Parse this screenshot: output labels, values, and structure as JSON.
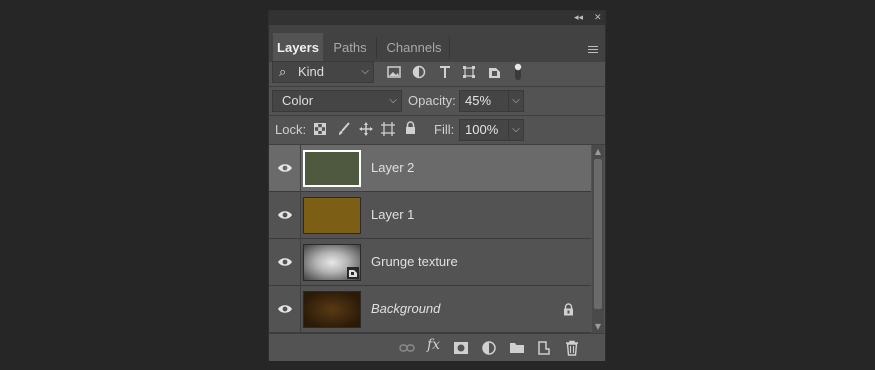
{
  "window": {
    "collapse_glyph": "◂◂",
    "close_glyph": "✕"
  },
  "tabs": [
    {
      "label": "Layers",
      "active": true
    },
    {
      "label": "Paths",
      "active": false
    },
    {
      "label": "Channels",
      "active": false
    }
  ],
  "filter": {
    "search_glyph": "⌕",
    "kind_label": "Kind",
    "icons": [
      "image-filter-icon",
      "adjustment-filter-icon",
      "type-filter-icon",
      "shape-filter-icon",
      "smart-object-filter-icon",
      "filter-toggle-icon"
    ]
  },
  "blend": {
    "mode": "Color",
    "opacity_label": "Opacity:",
    "opacity_value": "45%"
  },
  "lock": {
    "label": "Lock:",
    "icons": [
      "lock-transparent-icon",
      "lock-image-icon",
      "lock-position-icon",
      "lock-artboard-icon",
      "lock-all-icon"
    ],
    "fill_label": "Fill:",
    "fill_value": "100%"
  },
  "layers": [
    {
      "name": "Layer 2",
      "selected": true,
      "thumb_color": "#4f5940",
      "italic": false,
      "smart": false,
      "locked": false
    },
    {
      "name": "Layer 1",
      "selected": false,
      "thumb_color": "#7c5f14",
      "italic": false,
      "smart": false,
      "locked": false
    },
    {
      "name": "Grunge texture",
      "selected": false,
      "thumb_color": "#9a9a9a",
      "italic": false,
      "smart": true,
      "locked": false
    },
    {
      "name": "Background",
      "selected": false,
      "thumb_color": "#3a2510",
      "italic": true,
      "smart": false,
      "locked": true
    }
  ],
  "bottom_icons": [
    "link-layers-icon",
    "fx-icon",
    "layer-mask-icon",
    "adjustment-layer-icon",
    "group-folder-icon",
    "new-layer-icon",
    "trash-icon"
  ],
  "colors": {
    "panel_bg": "#535353",
    "page_bg": "#262626",
    "selected_row": "#6a6a6a"
  }
}
